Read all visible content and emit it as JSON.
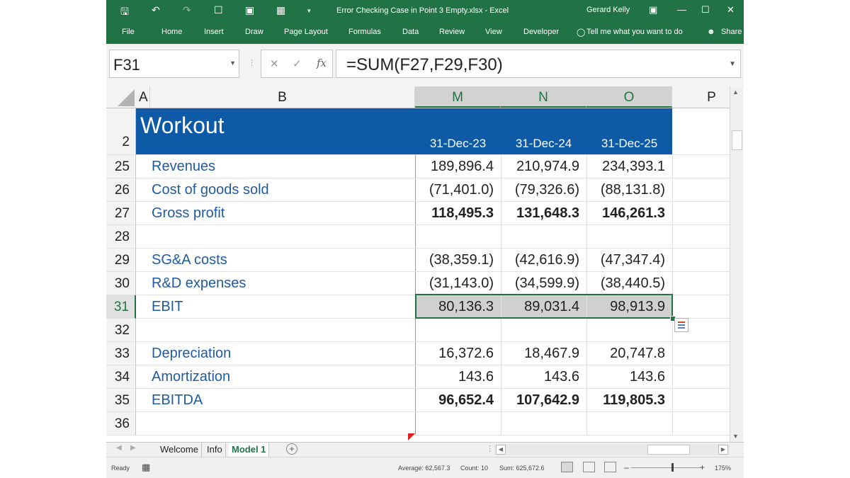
{
  "window": {
    "title": "Error Checking Case in Point 3 Empty.xlsx  -  Excel",
    "user": "Gerard Kelly"
  },
  "quick_access": {
    "save_icon": "save-icon",
    "undo_icon": "undo-icon",
    "redo_icon": "redo-icon"
  },
  "ribbon": {
    "tabs": [
      "File",
      "Home",
      "Insert",
      "Draw",
      "Page Layout",
      "Formulas",
      "Data",
      "Review",
      "View",
      "Developer"
    ],
    "tell_me": "Tell me what you want to do",
    "share": "Share"
  },
  "formula_bar": {
    "name_box": "F31",
    "formula": "=SUM(F27,F29,F30)",
    "fx_label": "fx"
  },
  "columns": [
    {
      "label": "A",
      "selected": false
    },
    {
      "label": "B",
      "selected": false
    },
    {
      "label": "M",
      "selected": true
    },
    {
      "label": "N",
      "selected": true
    },
    {
      "label": "O",
      "selected": true
    },
    {
      "label": "P",
      "selected": false
    }
  ],
  "header_row": {
    "row": "2",
    "title": "Workout",
    "dates": [
      "31-Dec-23",
      "31-Dec-24",
      "31-Dec-25"
    ]
  },
  "rows": [
    {
      "row": "25",
      "label": "Revenues",
      "values": [
        "189,896.4",
        "210,974.9",
        "234,393.1"
      ],
      "bold": false
    },
    {
      "row": "26",
      "label": "Cost of goods sold",
      "values": [
        "(71,401.0)",
        "(79,326.6)",
        "(88,131.8)"
      ],
      "bold": false
    },
    {
      "row": "27",
      "label": "Gross profit",
      "values": [
        "118,495.3",
        "131,648.3",
        "146,261.3"
      ],
      "bold": true
    },
    {
      "row": "28",
      "label": "",
      "values": [
        "",
        "",
        ""
      ],
      "bold": false
    },
    {
      "row": "29",
      "label": "SG&A costs",
      "values": [
        "(38,359.1)",
        "(42,616.9)",
        "(47,347.4)"
      ],
      "bold": false
    },
    {
      "row": "30",
      "label": "R&D expenses",
      "values": [
        "(31,143.0)",
        "(34,599.9)",
        "(38,440.5)"
      ],
      "bold": false
    },
    {
      "row": "31",
      "label": "EBIT",
      "values": [
        "80,136.3",
        "89,031.4",
        "98,913.9"
      ],
      "bold": false,
      "selected": true
    },
    {
      "row": "32",
      "label": "",
      "values": [
        "",
        "",
        ""
      ],
      "bold": false
    },
    {
      "row": "33",
      "label": "Depreciation",
      "values": [
        "16,372.6",
        "18,467.9",
        "20,747.8"
      ],
      "bold": false
    },
    {
      "row": "34",
      "label": "Amortization",
      "values": [
        "143.6",
        "143.6",
        "143.6"
      ],
      "bold": false
    },
    {
      "row": "35",
      "label": "EBITDA",
      "values": [
        "96,652.4",
        "107,642.9",
        "119,805.3"
      ],
      "bold": true
    },
    {
      "row": "36",
      "label": "",
      "values": [
        "",
        "",
        ""
      ],
      "bold": false
    }
  ],
  "sheets": [
    {
      "name": "Welcome",
      "active": false
    },
    {
      "name": "Info",
      "active": false
    },
    {
      "name": "Model 1",
      "active": true
    }
  ],
  "status_bar": {
    "mode": "Ready",
    "average": "Average: 62,567.3",
    "count": "Count: 10",
    "sum": "Sum: 625,672.6",
    "zoom": "175%"
  }
}
